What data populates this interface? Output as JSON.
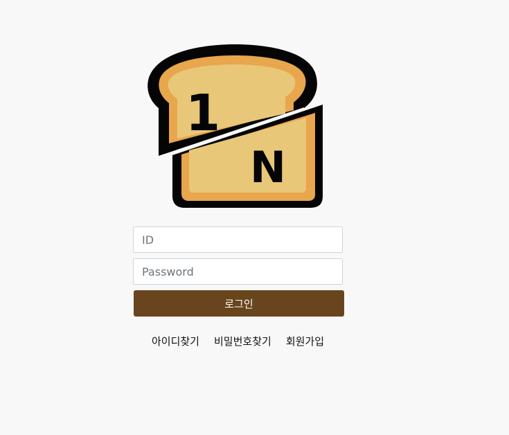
{
  "logo": {
    "name": "bread-logo",
    "top_text": "1",
    "bottom_text": "N",
    "colors": {
      "outline": "#050505",
      "crust": "#e8a64d",
      "bread": "#e9c778"
    }
  },
  "login_form": {
    "id_placeholder": "ID",
    "password_placeholder": "Password",
    "login_label": "로그인"
  },
  "footer_links": {
    "find_id": "아이디찾기",
    "find_password": "비밀번호찾기",
    "sign_up": "회원가입"
  },
  "colors": {
    "background": "#f8f8f8",
    "primary_button": "#68451d",
    "input_border": "#ced4da"
  }
}
